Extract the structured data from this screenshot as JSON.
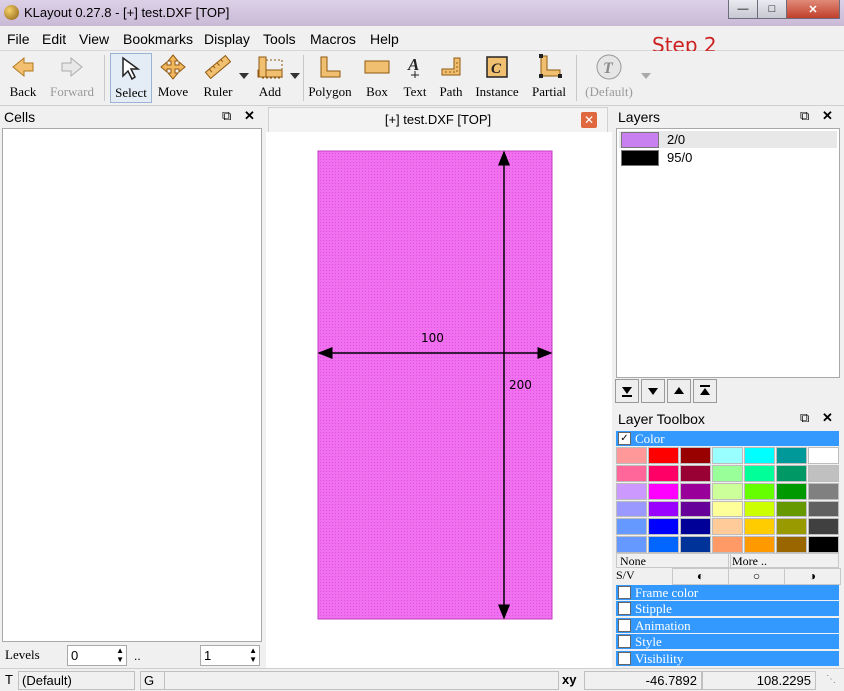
{
  "window": {
    "title": "KLayout 0.27.8 - [+] test.DXF [TOP]"
  },
  "annotation": {
    "step": "Step 2"
  },
  "menu": [
    "File",
    "Edit",
    "View",
    "Bookmarks",
    "Display",
    "Tools",
    "Macros",
    "Help"
  ],
  "toolbar": {
    "back": "Back",
    "forward": "Forward",
    "select": "Select",
    "move": "Move",
    "ruler": "Ruler",
    "add": "Add",
    "polygon": "Polygon",
    "box": "Box",
    "text": "Text",
    "path": "Path",
    "instance": "Instance",
    "partial": "Partial",
    "default": "(Default)"
  },
  "cells_panel": {
    "title": "Cells"
  },
  "document": {
    "tab": "[+] test.DXF [TOP]"
  },
  "canvas": {
    "shape_color": "#f080f0",
    "ruler_horizontal_label": "100",
    "ruler_vertical_label": "200"
  },
  "layers_panel": {
    "title": "Layers",
    "layers": [
      {
        "name": "2/0",
        "color": "#c880f0"
      },
      {
        "name": "95/0",
        "color": "#000000"
      }
    ]
  },
  "toolbox": {
    "title": "Layer Toolbox",
    "color_label": "Color",
    "palette": [
      "#ff9999",
      "#ff0000",
      "#990000",
      "#99ffff",
      "#00ffff",
      "#009999",
      "#ffffff",
      "#ff6699",
      "#ff0066",
      "#990033",
      "#99ff99",
      "#00ff99",
      "#009966",
      "#c0c0c0",
      "#cc99ff",
      "#ff00ff",
      "#990099",
      "#ccff99",
      "#66ff00",
      "#009900",
      "#808080",
      "#9999ff",
      "#9900ff",
      "#660099",
      "#ffff99",
      "#ccff00",
      "#669900",
      "#606060",
      "#6699ff",
      "#0000ff",
      "#000099",
      "#ffcc99",
      "#ffcc00",
      "#999900",
      "#404040",
      "#6699ff",
      "#0066ff",
      "#003399",
      "#ff9966",
      "#ff9900",
      "#996600",
      "#000000"
    ],
    "none_label": "None",
    "more_label": "More ..",
    "sv_label": "S/V",
    "sections": [
      "Frame color",
      "Stipple",
      "Animation",
      "Style",
      "Visibility"
    ]
  },
  "levels": {
    "label": "Levels",
    "from": "0",
    "to": "1",
    "sep": ".."
  },
  "status": {
    "mode": "T",
    "template": "(Default)",
    "grid": "G",
    "xy_label": "xy",
    "x": "-46.7892",
    "y": "108.2295"
  }
}
